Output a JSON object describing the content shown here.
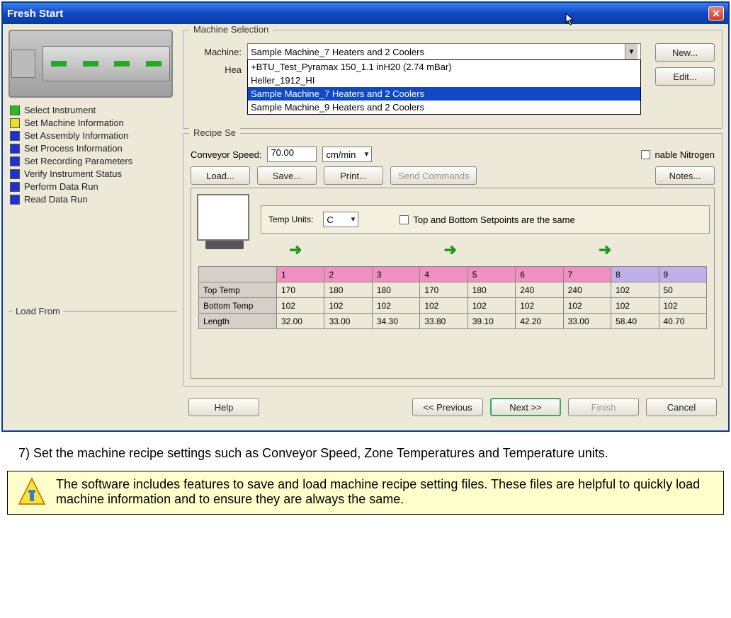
{
  "window": {
    "title": "Fresh Start"
  },
  "steps": [
    {
      "color": "green",
      "label": "Select Instrument"
    },
    {
      "color": "yellow",
      "label": "Set Machine Information"
    },
    {
      "color": "blue",
      "label": "Set Assembly Information"
    },
    {
      "color": "blue",
      "label": "Set Process Information"
    },
    {
      "color": "blue",
      "label": "Set Recording Parameters"
    },
    {
      "color": "blue",
      "label": "Verify Instrument Status"
    },
    {
      "color": "blue",
      "label": "Perform Data Run"
    },
    {
      "color": "blue",
      "label": "Read Data Run"
    }
  ],
  "loadFromLabel": "Load From",
  "machineSelection": {
    "title": "Machine Selection",
    "machineLabel": "Machine:",
    "heaterLabel": "Hea",
    "selected": "Sample Machine_7 Heaters and 2 Coolers",
    "options": [
      "+BTU_Test_Pyramax 150_1.1 inH20 (2.74 mBar)",
      "Heller_1912_HI",
      "Sample Machine_7 Heaters and 2 Coolers",
      "Sample Machine_9 Heaters and 2 Coolers"
    ],
    "newBtn": "New...",
    "editBtn": "Edit..."
  },
  "recipe": {
    "title": "Recipe Se",
    "conveyorLabel": "Conveyor Speed:",
    "conveyorValue": "70.00",
    "conveyorUnit": "cm/min",
    "nitrogenLabel": "nable Nitrogen",
    "loadBtn": "Load...",
    "saveBtn": "Save...",
    "printBtn": "Print...",
    "sendBtn": "Send Commands",
    "notesBtn": "Notes..."
  },
  "tempPanel": {
    "label": "Temp Units:",
    "unit": "C",
    "sameLabel": "Top and Bottom Setpoints are the same"
  },
  "zones": {
    "headers": [
      "1",
      "2",
      "3",
      "4",
      "5",
      "6",
      "7",
      "8",
      "9"
    ],
    "headerColors": [
      "pink",
      "pink",
      "pink",
      "pink",
      "pink",
      "pink",
      "pink",
      "lav",
      "lav"
    ],
    "rows": [
      {
        "label": "Top Temp",
        "vals": [
          "170",
          "180",
          "180",
          "170",
          "180",
          "240",
          "240",
          "102",
          "50"
        ]
      },
      {
        "label": "Bottom Temp",
        "vals": [
          "102",
          "102",
          "102",
          "102",
          "102",
          "102",
          "102",
          "102",
          "102"
        ]
      },
      {
        "label": "Length",
        "vals": [
          "32.00",
          "33.00",
          "34.30",
          "33.80",
          "39.10",
          "42.20",
          "33.00",
          "58.40",
          "40.70"
        ]
      }
    ]
  },
  "nav": {
    "help": "Help",
    "prev": "<< Previous",
    "next": "Next >>",
    "finish": "Finish",
    "cancel": "Cancel"
  },
  "doc": {
    "stepText": "7)  Set the machine recipe settings such as Conveyor Speed, Zone Temperatures and Temperature units.",
    "noteText": "The software includes features to save and load machine recipe setting files. These files are helpful to quickly load machine information and to ensure they are always the same."
  }
}
